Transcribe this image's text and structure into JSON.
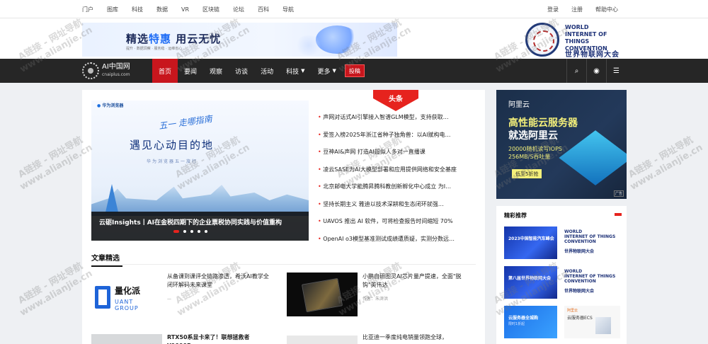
{
  "topbar": {
    "links": [
      "门户",
      "图库",
      "科技",
      "数据",
      "VR",
      "区块链",
      "论坛",
      "百科",
      "导航"
    ],
    "right_links": [
      "登录",
      "注册",
      "帮助中心"
    ]
  },
  "header": {
    "ad": {
      "title_a": "精选",
      "title_b": "特惠",
      "title_c": " 用云无忧",
      "sub": "提升 · 数据洞察 · 服务稳 · 运维省心"
    },
    "wiot": {
      "line1": "WORLD",
      "line2": "INTERNET OF THINGS",
      "line3": "CONVENTION",
      "cn": "世界物联网大会"
    }
  },
  "nav": {
    "logo_name": "AI中国网",
    "logo_domain": "cnaiplus.com",
    "items": [
      {
        "label": "首页",
        "active": true
      },
      {
        "label": "要闻"
      },
      {
        "label": "观察"
      },
      {
        "label": "访谈"
      },
      {
        "label": "活动"
      },
      {
        "label": "科技",
        "caret": "▼"
      },
      {
        "label": "更多",
        "caret": "▼"
      }
    ],
    "report": "投稿",
    "icons": [
      "search-icon",
      "wechat-icon",
      "menu-icon"
    ],
    "icon_glyphs": [
      "⌕",
      "◉",
      "☰"
    ]
  },
  "main": {
    "headline_tag": "头条",
    "slider": {
      "brand": "华为浏览器",
      "script": "五一 走哪指南",
      "big": "遇见心动目的地",
      "sub": "华为浏览器五一旅行",
      "caption": "云砺Insights丨AI在金税四期下的企业票税协同实践与价值重构",
      "dots": 5,
      "active_dot": 0
    },
    "news": [
      "声网对话式AI引擎接入智谱GLM模型，支持获取…",
      "爱签入榜2025年浙江省种子独角兽：以AI赋构电…",
      "豆神AI&声网 打造AI超拟人多对一直播课",
      "凌云SASE为AI大模型部署和应用提供网络和安全基座",
      "北京邮电大学能腾昇腾科教创新孵化中心成立 为I…",
      "坚持长期主义 雅迪以技术深耕和生态闭环就强…",
      "UAVOS 推出 AI 软件，可将检查报告时间缩短 70%",
      "OpenAI o3模型基准测试成绩遭质疑，实测分数远…"
    ],
    "section_title": "文章精选",
    "articles": [
      {
        "thumb": "quant",
        "brand": "量化派",
        "brand_sub1": "UANT",
        "brand_sub2": "GROUP",
        "title": "从备课到课评全链路渗透，希沃AI教学全闭环解码未来课堂",
        "meta": "—"
      },
      {
        "thumb": "chip",
        "title": "小鹏自研图灵AI芯片量产提速，全面\"脱钩\"英伟达",
        "meta": "作者：朱湃洪"
      },
      {
        "thumb": "gray",
        "title": "RTX50系显卡来了！联想拯救者Y9000P",
        "meta": ""
      },
      {
        "thumb": "gray",
        "title": "比亚迪一季度纯电销量领跑全球，",
        "meta": ""
      }
    ]
  },
  "sidebar": {
    "ad": {
      "brand": "阿里云",
      "h1": "高性能云服务器",
      "h2": "就选阿里云",
      "s1": "20000随机读写IOPS",
      "s2": "256MB/S吞吐量",
      "cta": "低至5折抢",
      "tag": "广告"
    },
    "featured_title": "精彩推荐",
    "featured": [
      {
        "img_t1": "2023中国智能汽车峰会",
        "img_t2": "",
        "w1": "WORLD",
        "w2": "INTERNET OF THINGS",
        "w3": "CONVENTION",
        "cn": "世界物联网大会"
      },
      {
        "img_t1": "第八届世界物联网大会",
        "img_t2": "",
        "w1": "WORLD",
        "w2": "INTERNET OF THINGS",
        "w3": "CONVENTION",
        "cn": "世界物联网大会"
      },
      {
        "img_t1": "云服务器全城购",
        "img_t2": "限时1折起",
        "ecs1": "阿里云",
        "ecs2": "云服务器ECS"
      }
    ]
  },
  "watermark": {
    "line1": "A链接 - 网址导航",
    "line2": "www.alianjie.cn"
  },
  "colors": {
    "accent_red": "#c8161d",
    "nav_bg": "#262626",
    "brand_blue": "#1d3177"
  }
}
